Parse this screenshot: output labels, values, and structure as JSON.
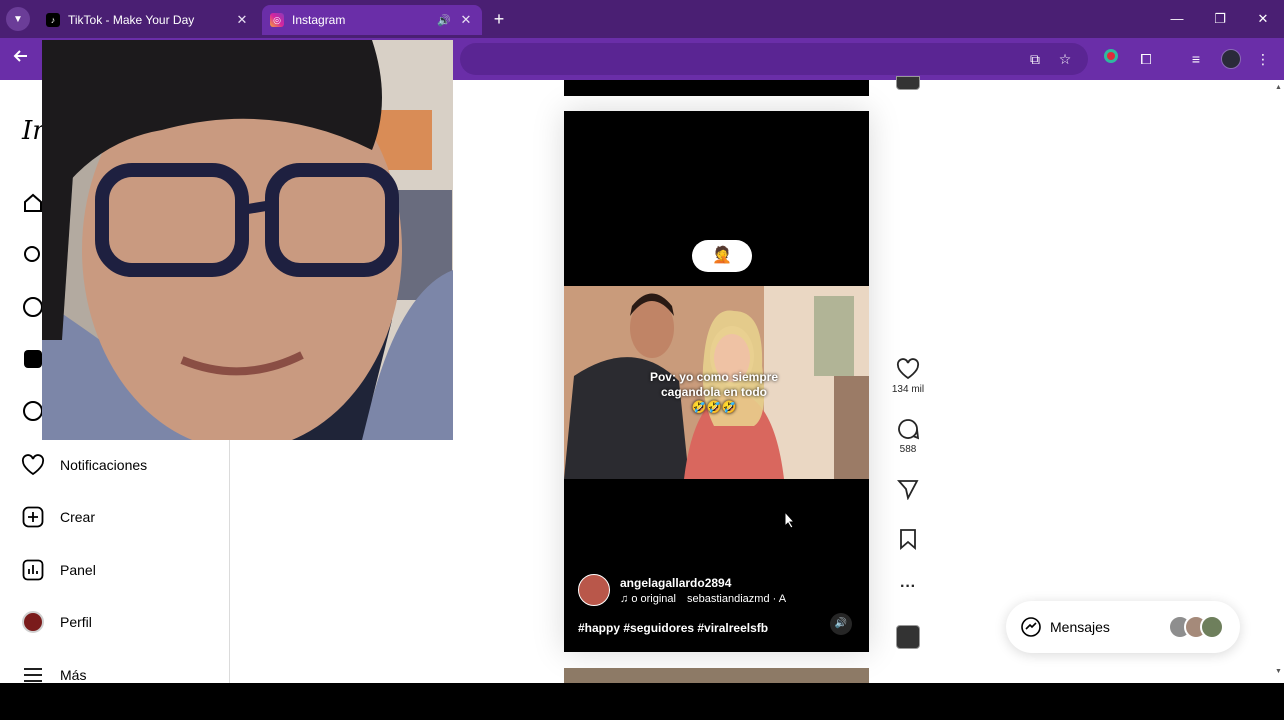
{
  "tabs": [
    {
      "title": "TikTok - Make Your Day",
      "favicon": "tiktok-icon",
      "active": false
    },
    {
      "title": "Instagram",
      "favicon": "instagram-icon",
      "active": true,
      "audio": true
    }
  ],
  "window_controls": {
    "minimize": "—",
    "restore": "❐",
    "close": "✕"
  },
  "sidebar": {
    "logo": "In",
    "items": [
      {
        "label": "Notificaciones",
        "icon": "heart-icon"
      },
      {
        "label": "Crear",
        "icon": "plus-square-icon"
      },
      {
        "label": "Panel",
        "icon": "chart-icon"
      },
      {
        "label": "Perfil",
        "icon": "avatar"
      },
      {
        "label": "Más",
        "icon": "menu-icon"
      }
    ]
  },
  "reel": {
    "emoji": "🤦",
    "caption_line1": "Pov: yo como siempre",
    "caption_line2": "cagandola en todo",
    "caption_emojis": "🤣🤣🤣",
    "username": "angelagallardo2894",
    "audio_label": "o original",
    "audio_author": "sebastiandiazmd · A",
    "hashtags": "#happy #seguidores #viralreelsfb"
  },
  "actions": {
    "likes": "134 mil",
    "comments": "588"
  },
  "messages": {
    "label": "Mensajes"
  },
  "colors": {
    "tabstrip": "#4a1f73",
    "toolbar": "#6a2ea8",
    "reel_bg": "#000000"
  }
}
